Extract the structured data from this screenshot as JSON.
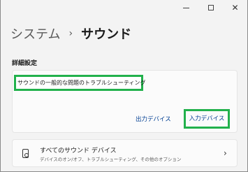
{
  "caption": {
    "minimize_icon": "minimize-icon",
    "maximize_icon": "maximize-icon",
    "close_glyph": "✕"
  },
  "breadcrumb": {
    "parent": "システム",
    "separator": "›",
    "current": "サウンド"
  },
  "advanced": {
    "label": "詳細設定",
    "troubleshoot_link": "サウンドの一般的な問題のトラブルシューティング",
    "output_device_button": "出力デバイス",
    "input_device_button": "入力デバイス"
  },
  "all_devices": {
    "icon": "speaker-icon",
    "title": "すべてのサウンド デバイス",
    "subtitle": "デバイスのオン/オフ、トラブルシューティング、その他のオプション",
    "chevron": "›"
  },
  "colors": {
    "highlight": "#22b14c",
    "link": "#003e92",
    "background": "#f3f3f3",
    "card": "#fbfbfb"
  }
}
